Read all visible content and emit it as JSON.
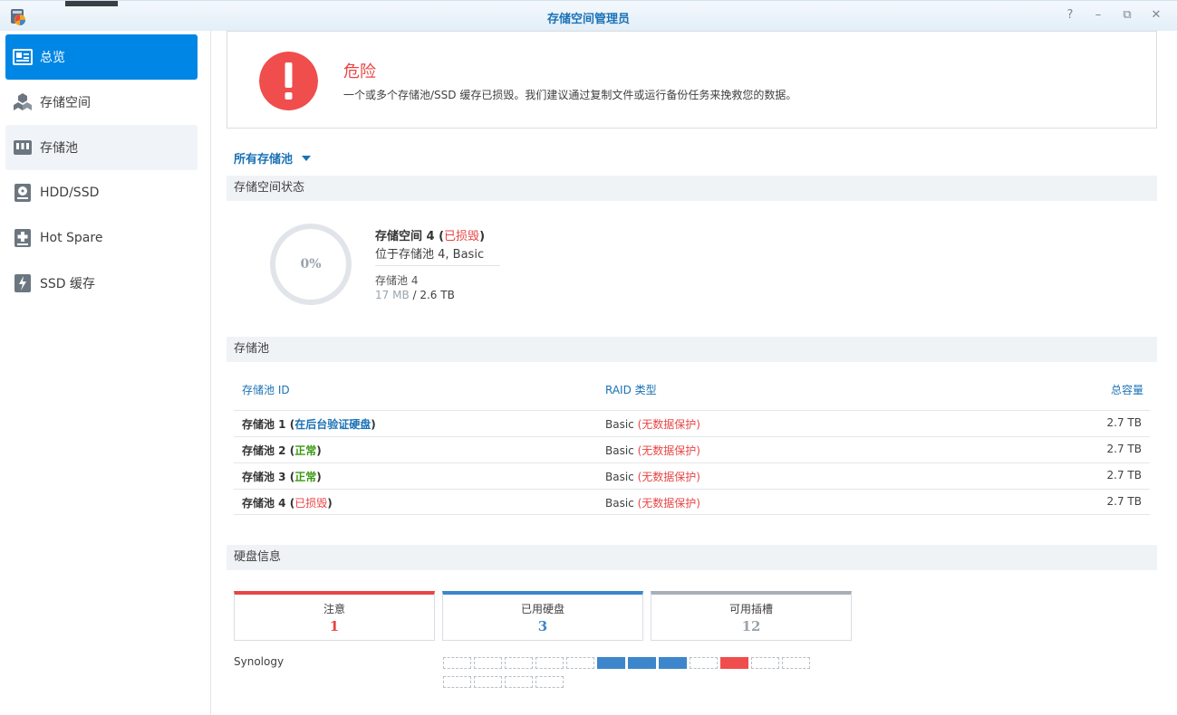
{
  "window": {
    "title": "存储空间管理员",
    "controls": [
      "?",
      "–",
      "⧉",
      "✕"
    ]
  },
  "sidebar": {
    "items": [
      {
        "label": "总览",
        "icon": "overview-icon",
        "active": true
      },
      {
        "label": "存储空间",
        "icon": "volume-cubes-icon"
      },
      {
        "label": "存储池",
        "icon": "storage-pool-icon"
      },
      {
        "label": "HDD/SSD",
        "icon": "hdd-icon"
      },
      {
        "label": "Hot Spare",
        "icon": "hot-spare-icon"
      },
      {
        "label": "SSD 缓存",
        "icon": "ssd-cache-icon"
      }
    ]
  },
  "alert": {
    "title": "危险",
    "description": "一个或多个存储池/SSD 缓存已损毁。我们建议通过复制文件或运行备份任务来挽救您的数据。",
    "color": "#f04d4d"
  },
  "filter": {
    "label": "所有存储池"
  },
  "volume_section": {
    "header": "存储空间状态",
    "usage_percent": "0%",
    "name": "存储空间 4",
    "status": "已损毁",
    "location": "位于存储池 4, Basic",
    "pool": "存储池 4",
    "used": "17 MB",
    "separator": " / ",
    "total": "2.6 TB"
  },
  "pool_section": {
    "header": "存储池",
    "columns": [
      "存储池 ID",
      "RAID 类型",
      "总容量"
    ],
    "rows": [
      {
        "name": "存储池 1",
        "status": "在后台验证硬盘",
        "status_color": "blue",
        "raid": "Basic",
        "raid_note": "(无数据保护)",
        "capacity": "2.7 TB"
      },
      {
        "name": "存储池 2",
        "status": "正常",
        "status_color": "green",
        "raid": "Basic",
        "raid_note": "(无数据保护)",
        "capacity": "2.7 TB"
      },
      {
        "name": "存储池 3",
        "status": "正常",
        "status_color": "green",
        "raid": "Basic",
        "raid_note": "(无数据保护)",
        "capacity": "2.7 TB"
      },
      {
        "name": "存储池 4",
        "status": "已损毁",
        "status_color": "red",
        "raid": "Basic",
        "raid_note": "(无数据保护)",
        "capacity": "2.7 TB"
      }
    ]
  },
  "disk_section": {
    "header": "硬盘信息",
    "cards": [
      {
        "label": "注意",
        "value": "1",
        "color": "#e84545"
      },
      {
        "label": "已用硬盘",
        "value": "3",
        "color": "#3d86cc"
      },
      {
        "label": "可用插槽",
        "value": "12",
        "color": "#a7b0b8"
      }
    ],
    "device": "Synology",
    "slots_row1": [
      "empty",
      "empty",
      "empty",
      "empty",
      "empty",
      "used",
      "used",
      "used",
      "empty",
      "bad",
      "empty",
      "empty"
    ],
    "slots_row2": [
      "empty",
      "empty",
      "empty",
      "empty"
    ]
  }
}
